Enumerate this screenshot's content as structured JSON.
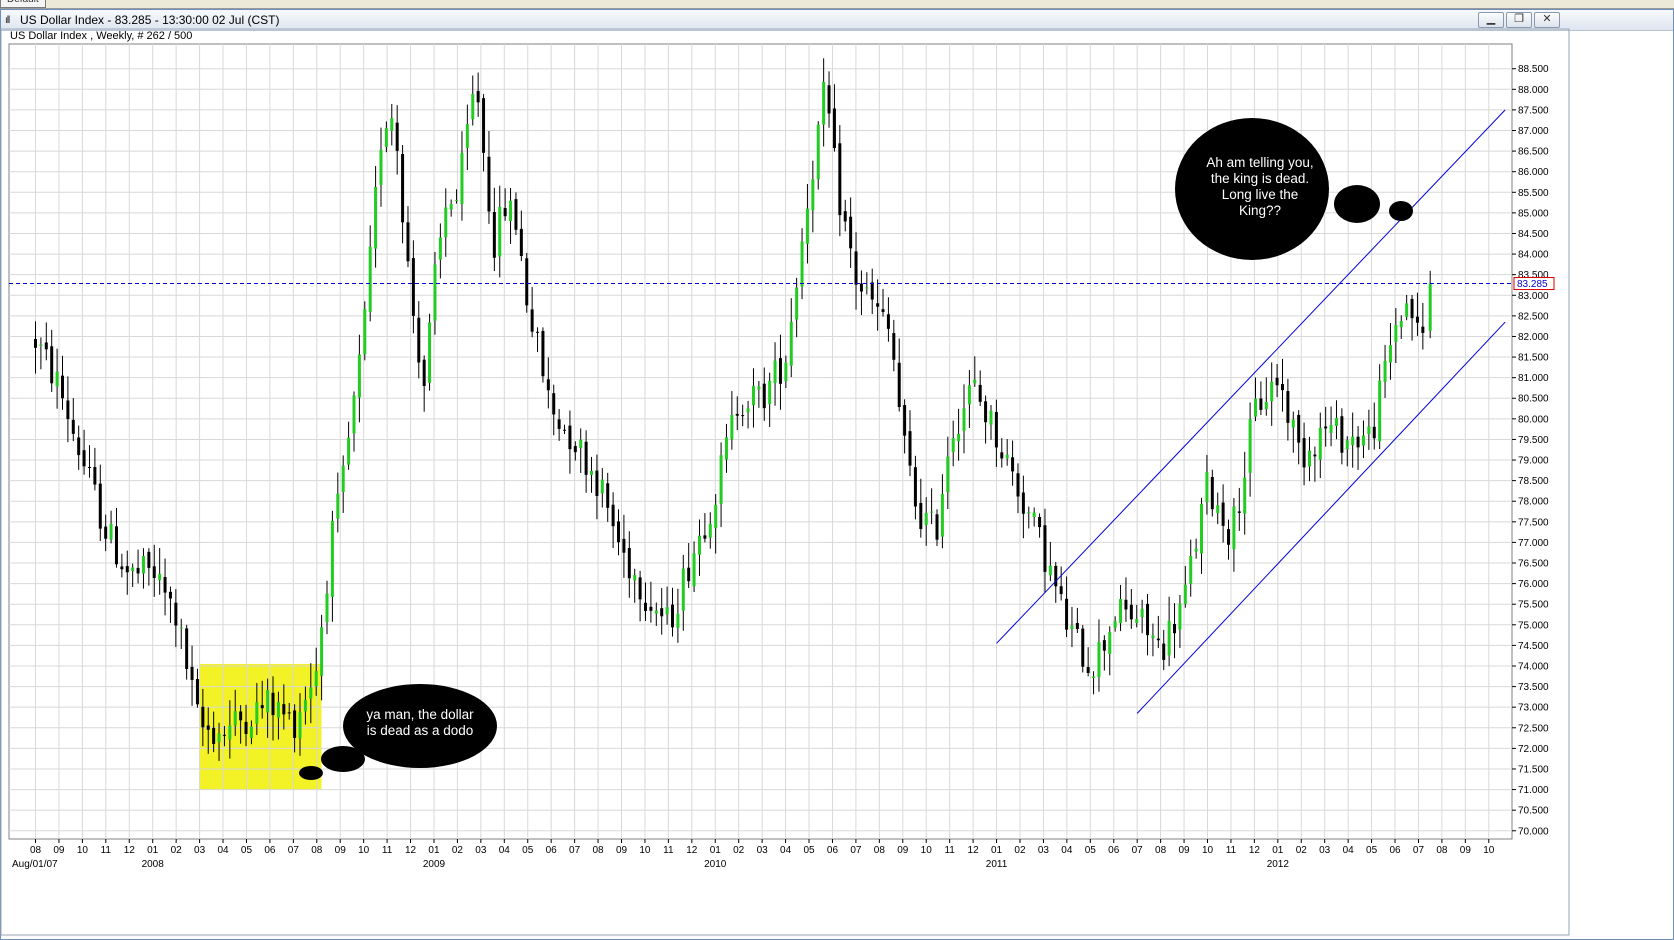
{
  "topbar": {
    "tab_label": "Default"
  },
  "window": {
    "icon": "chart-bars-icon",
    "title": "US Dollar Index - 83.285 - 13:30:00  02 Jul (CST)",
    "buttons": {
      "minimize": "minimize-icon",
      "restore": "restore-icon",
      "close": "close-icon"
    }
  },
  "chart_subtitle": "US Dollar Index , Weekly, # 262 / 500",
  "colors": {
    "up": "#22cc22",
    "down": "#000000",
    "grid": "#d8d8d8",
    "price_line": "#0000cc",
    "channel": "#0000dd",
    "highlight": "#f0f000",
    "bubble": "#000000"
  },
  "chart_data": {
    "type": "candlestick",
    "title": "US Dollar Index",
    "timeframe": "Weekly",
    "ylim": [
      69.8,
      89.1
    ],
    "yticks": [
      70.0,
      70.5,
      71.0,
      71.5,
      72.0,
      72.5,
      73.0,
      73.5,
      74.0,
      74.5,
      75.0,
      75.5,
      76.0,
      76.5,
      77.0,
      77.5,
      78.0,
      78.5,
      79.0,
      79.5,
      80.0,
      80.5,
      81.0,
      81.5,
      82.0,
      82.5,
      83.0,
      83.5,
      84.0,
      84.5,
      85.0,
      85.5,
      86.0,
      86.5,
      87.0,
      87.5,
      88.0,
      88.5
    ],
    "ytick_labels": [
      "70.000",
      "70.500",
      "71.000",
      "71.500",
      "72.000",
      "72.500",
      "73.000",
      "73.500",
      "74.000",
      "74.500",
      "75.000",
      "75.500",
      "76.000",
      "76.500",
      "77.000",
      "77.500",
      "78.000",
      "78.500",
      "79.000",
      "79.500",
      "80.000",
      "80.500",
      "81.000",
      "81.500",
      "82.000",
      "82.500",
      "83.000",
      "83.500",
      "84.000",
      "84.500",
      "85.000",
      "85.500",
      "86.000",
      "86.500",
      "87.000",
      "87.500",
      "88.000",
      "88.500"
    ],
    "month_ticks": [
      "08",
      "09",
      "10",
      "11",
      "12",
      "01",
      "02",
      "03",
      "04",
      "05",
      "06",
      "07",
      "08",
      "09",
      "10",
      "11",
      "12",
      "01",
      "02",
      "03",
      "04",
      "05",
      "06",
      "07",
      "08",
      "09",
      "10",
      "11",
      "12",
      "01",
      "02",
      "03",
      "04",
      "05",
      "06",
      "07",
      "08",
      "09",
      "10",
      "11",
      "12",
      "01",
      "02",
      "03",
      "04",
      "05",
      "06",
      "07",
      "08",
      "09",
      "10",
      "11",
      "12",
      "01",
      "02",
      "03",
      "04",
      "05",
      "06",
      "07",
      "08",
      "09",
      "10"
    ],
    "year_labels": [
      {
        "label": "Aug/01/07",
        "month_index": 0
      },
      {
        "label": "2008",
        "month_index": 5
      },
      {
        "label": "2009",
        "month_index": 17
      },
      {
        "label": "2010",
        "month_index": 29
      },
      {
        "label": "2011",
        "month_index": 41
      },
      {
        "label": "2012",
        "month_index": 53
      }
    ],
    "last_price": 83.285,
    "last_price_label": "83.285",
    "anchors": [
      {
        "month": 0.0,
        "price": 81.9
      },
      {
        "month": 1.0,
        "price": 80.8
      },
      {
        "month": 2.0,
        "price": 79.0
      },
      {
        "month": 3.0,
        "price": 77.3
      },
      {
        "month": 4.0,
        "price": 76.2
      },
      {
        "month": 5.0,
        "price": 76.3
      },
      {
        "month": 6.0,
        "price": 75.2
      },
      {
        "month": 7.0,
        "price": 72.5
      },
      {
        "month": 8.0,
        "price": 72.4
      },
      {
        "month": 9.0,
        "price": 72.8
      },
      {
        "month": 10.0,
        "price": 73.1
      },
      {
        "month": 11.0,
        "price": 72.6
      },
      {
        "month": 12.0,
        "price": 74.0
      },
      {
        "month": 12.6,
        "price": 77.0
      },
      {
        "month": 13.0,
        "price": 78.0
      },
      {
        "month": 14.0,
        "price": 82.0
      },
      {
        "month": 14.8,
        "price": 87.2
      },
      {
        "month": 15.3,
        "price": 87.5
      },
      {
        "month": 16.0,
        "price": 83.0
      },
      {
        "month": 16.6,
        "price": 80.8
      },
      {
        "month": 17.0,
        "price": 83.2
      },
      {
        "month": 17.6,
        "price": 85.5
      },
      {
        "month": 18.0,
        "price": 85.3
      },
      {
        "month": 18.8,
        "price": 88.3
      },
      {
        "month": 19.2,
        "price": 86.0
      },
      {
        "month": 19.6,
        "price": 84.2
      },
      {
        "month": 20.0,
        "price": 85.2
      },
      {
        "month": 20.5,
        "price": 84.8
      },
      {
        "month": 21.0,
        "price": 82.8
      },
      {
        "month": 22.0,
        "price": 80.2
      },
      {
        "month": 23.0,
        "price": 79.5
      },
      {
        "month": 24.0,
        "price": 78.5
      },
      {
        "month": 25.0,
        "price": 76.8
      },
      {
        "month": 26.0,
        "price": 75.8
      },
      {
        "month": 27.0,
        "price": 75.0
      },
      {
        "month": 28.0,
        "price": 76.7
      },
      {
        "month": 29.0,
        "price": 78.2
      },
      {
        "month": 30.0,
        "price": 80.5
      },
      {
        "month": 31.0,
        "price": 80.5
      },
      {
        "month": 32.0,
        "price": 81.5
      },
      {
        "month": 33.0,
        "price": 85.6
      },
      {
        "month": 33.7,
        "price": 88.0
      },
      {
        "month": 34.2,
        "price": 85.6
      },
      {
        "month": 35.0,
        "price": 83.4
      },
      {
        "month": 36.0,
        "price": 82.5
      },
      {
        "month": 36.5,
        "price": 82.0
      },
      {
        "month": 37.0,
        "price": 79.5
      },
      {
        "month": 37.6,
        "price": 77.8
      },
      {
        "month": 38.4,
        "price": 77.2
      },
      {
        "month": 39.0,
        "price": 79.6
      },
      {
        "month": 40.0,
        "price": 80.8
      },
      {
        "month": 41.0,
        "price": 79.6
      },
      {
        "month": 42.0,
        "price": 78.2
      },
      {
        "month": 43.0,
        "price": 76.8
      },
      {
        "month": 44.0,
        "price": 75.0
      },
      {
        "month": 45.0,
        "price": 74.0
      },
      {
        "month": 45.6,
        "price": 74.6
      },
      {
        "month": 46.0,
        "price": 75.3
      },
      {
        "month": 47.0,
        "price": 75.2
      },
      {
        "month": 48.0,
        "price": 74.4
      },
      {
        "month": 49.0,
        "price": 75.6
      },
      {
        "month": 50.0,
        "price": 78.4
      },
      {
        "month": 51.0,
        "price": 77.2
      },
      {
        "month": 51.5,
        "price": 78.5
      },
      {
        "month": 52.0,
        "price": 80.2
      },
      {
        "month": 53.0,
        "price": 81.0
      },
      {
        "month": 54.0,
        "price": 79.1
      },
      {
        "month": 55.0,
        "price": 79.8
      },
      {
        "month": 56.0,
        "price": 79.5
      },
      {
        "month": 57.0,
        "price": 79.6
      },
      {
        "month": 58.0,
        "price": 82.3
      },
      {
        "month": 58.6,
        "price": 82.9
      },
      {
        "month": 59.1,
        "price": 81.7
      },
      {
        "month": 59.5,
        "price": 83.285
      }
    ],
    "channel_lines": [
      {
        "name": "upper-channel",
        "points": [
          {
            "month": 41.0,
            "price": 74.55
          },
          {
            "month": 62.7,
            "price": 87.5
          }
        ]
      },
      {
        "name": "lower-channel",
        "points": [
          {
            "month": 47.0,
            "price": 72.85
          },
          {
            "month": 62.7,
            "price": 82.35
          }
        ]
      }
    ],
    "highlight_box": {
      "month_start": 7.0,
      "month_end": 12.2,
      "price_low": 71.0,
      "price_high": 74.05
    },
    "annotations": [
      {
        "name": "thought-bubble-top",
        "text_lines": [
          "Ah am telling you,",
          "the king is dead.",
          "Long live the",
          "King??"
        ]
      },
      {
        "name": "thought-bubble-bottom",
        "text_lines": [
          "ya man, the dollar",
          "is dead as a dodo"
        ]
      }
    ]
  }
}
